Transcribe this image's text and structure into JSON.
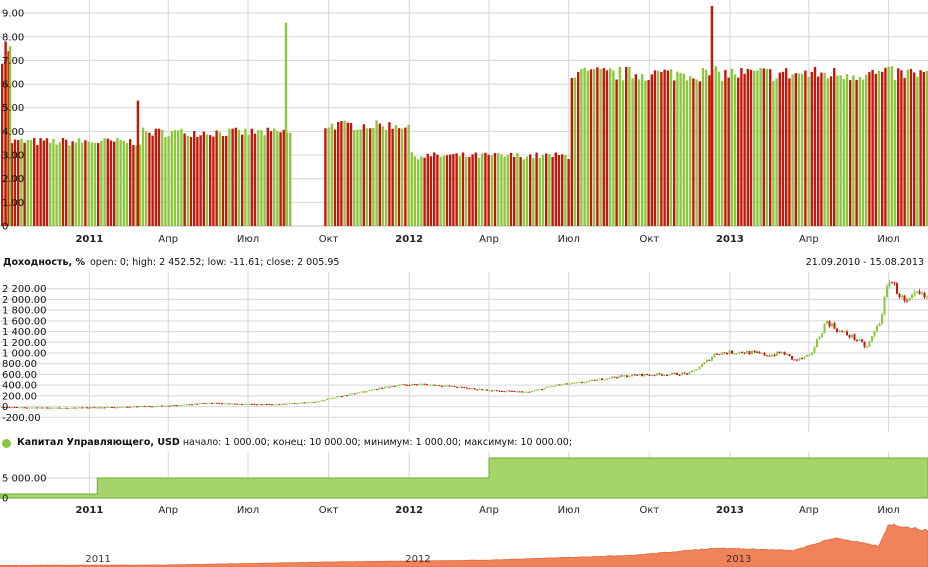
{
  "colors": {
    "up": "#8dc63f",
    "down": "#c0190b",
    "capital_fill": "#a5d46a",
    "capital_line": "#6fae2a",
    "navigator_fill": "#f0835a",
    "grid": "#d7d7d7"
  },
  "time_axis": {
    "labels": [
      "2011",
      "Апр",
      "Июл",
      "Окт",
      "2012",
      "Апр",
      "Июл",
      "Окт",
      "2013",
      "Апр",
      "Июл"
    ],
    "bold": [
      true,
      false,
      false,
      false,
      true,
      false,
      false,
      false,
      true,
      false,
      false
    ]
  },
  "yield_panel": {
    "title": "Доходность, %",
    "stats": "open: 0; high: 2 452.52; low: -11.61; close: 2 005.95",
    "range": "21.09.2010 - 15.08.2013"
  },
  "capital_panel": {
    "legend": "Капитал Управляющего, USD",
    "stats": "начало: 1 000.00; конец: 10 000.00; минимум: 1 000.00; максимум: 10 000.00;"
  },
  "navigator": {
    "labels": [
      "2011",
      "2012",
      "2013"
    ]
  },
  "chart_data": [
    {
      "type": "bar",
      "name": "top_bars",
      "y_ticks": [
        "0",
        "1.00",
        "2.00",
        "3.00",
        "4.00",
        "5.00",
        "6.00",
        "7.00",
        "8.00",
        "9.00"
      ],
      "ylim": [
        0,
        9.3
      ],
      "x_range": [
        "2010-09-21",
        "2013-08-15"
      ],
      "regimes": [
        {
          "start": "2010-09-21",
          "end": "2010-10-01",
          "level": 7.3
        },
        {
          "start": "2010-10-01",
          "end": "2011-03-01",
          "level": 3.6
        },
        {
          "start": "2011-03-01",
          "end": "2011-08-25",
          "level": 4.0
        },
        {
          "start": "2011-09-01",
          "end": "2011-12-31",
          "level": 4.3
        },
        {
          "start": "2012-01-01",
          "end": "2012-06-30",
          "level": 3.0
        },
        {
          "start": "2012-07-01",
          "end": "2013-08-15",
          "level": 6.5
        }
      ],
      "spikes": [
        {
          "date": "2010-09-26",
          "value": 7.8
        },
        {
          "date": "2010-10-01",
          "value": 7.6
        },
        {
          "date": "2011-02-24",
          "value": 5.3
        },
        {
          "date": "2011-08-12",
          "value": 8.6
        },
        {
          "date": "2012-12-10",
          "value": 9.3
        }
      ]
    },
    {
      "type": "line",
      "name": "yield",
      "y_ticks": [
        "-200.00",
        "0",
        "200.00",
        "400.00",
        "600.00",
        "800.00",
        "1 000.00",
        "1 200.00",
        "1 400.00",
        "1 600.00",
        "1 800.00",
        "2 000.00",
        "2 200.00"
      ],
      "ylim": [
        -250,
        2400
      ],
      "x": [
        "2010-09-21",
        "2010-12-01",
        "2011-02-01",
        "2011-04-01",
        "2011-05-15",
        "2011-06-15",
        "2011-08-01",
        "2011-09-15",
        "2011-10-15",
        "2011-11-15",
        "2011-12-15",
        "2012-01-15",
        "2012-02-15",
        "2012-04-01",
        "2012-05-15",
        "2012-06-15",
        "2012-07-15",
        "2012-08-15",
        "2012-09-15",
        "2012-10-15",
        "2012-11-15",
        "2012-12-01",
        "2012-12-15",
        "2013-01-15",
        "2013-02-15",
        "2013-03-01",
        "2013-03-15",
        "2013-04-01",
        "2013-04-20",
        "2013-05-05",
        "2013-05-20",
        "2013-06-05",
        "2013-06-20",
        "2013-07-01",
        "2013-07-10",
        "2013-07-20",
        "2013-08-01",
        "2013-08-15"
      ],
      "y": [
        -10,
        -25,
        -10,
        20,
        70,
        50,
        40,
        90,
        200,
        300,
        400,
        420,
        380,
        300,
        270,
        400,
        450,
        540,
        590,
        600,
        620,
        800,
        1000,
        1020,
        960,
        1010,
        860,
        940,
        1600,
        1400,
        1300,
        1100,
        1600,
        2400,
        2150,
        1900,
        2100,
        2006
      ]
    },
    {
      "type": "area",
      "name": "capital",
      "y_ticks": [
        "0",
        "5 000.00"
      ],
      "ylim": [
        0,
        10500
      ],
      "x": [
        "2010-09-21",
        "2011-01-10",
        "2011-01-10",
        "2012-04-01",
        "2012-04-01",
        "2013-08-15"
      ],
      "y": [
        1000,
        1000,
        5000,
        5000,
        10000,
        10000
      ]
    },
    {
      "type": "area",
      "name": "navigator",
      "x": [
        "2010-09-21",
        "2011-04-01",
        "2011-10-15",
        "2012-04-01",
        "2012-09-15",
        "2012-12-15",
        "2013-03-15",
        "2013-05-01",
        "2013-06-20",
        "2013-07-01",
        "2013-08-15"
      ],
      "y": [
        -10,
        20,
        200,
        300,
        590,
        1000,
        860,
        1600,
        1100,
        2400,
        2006
      ]
    }
  ]
}
